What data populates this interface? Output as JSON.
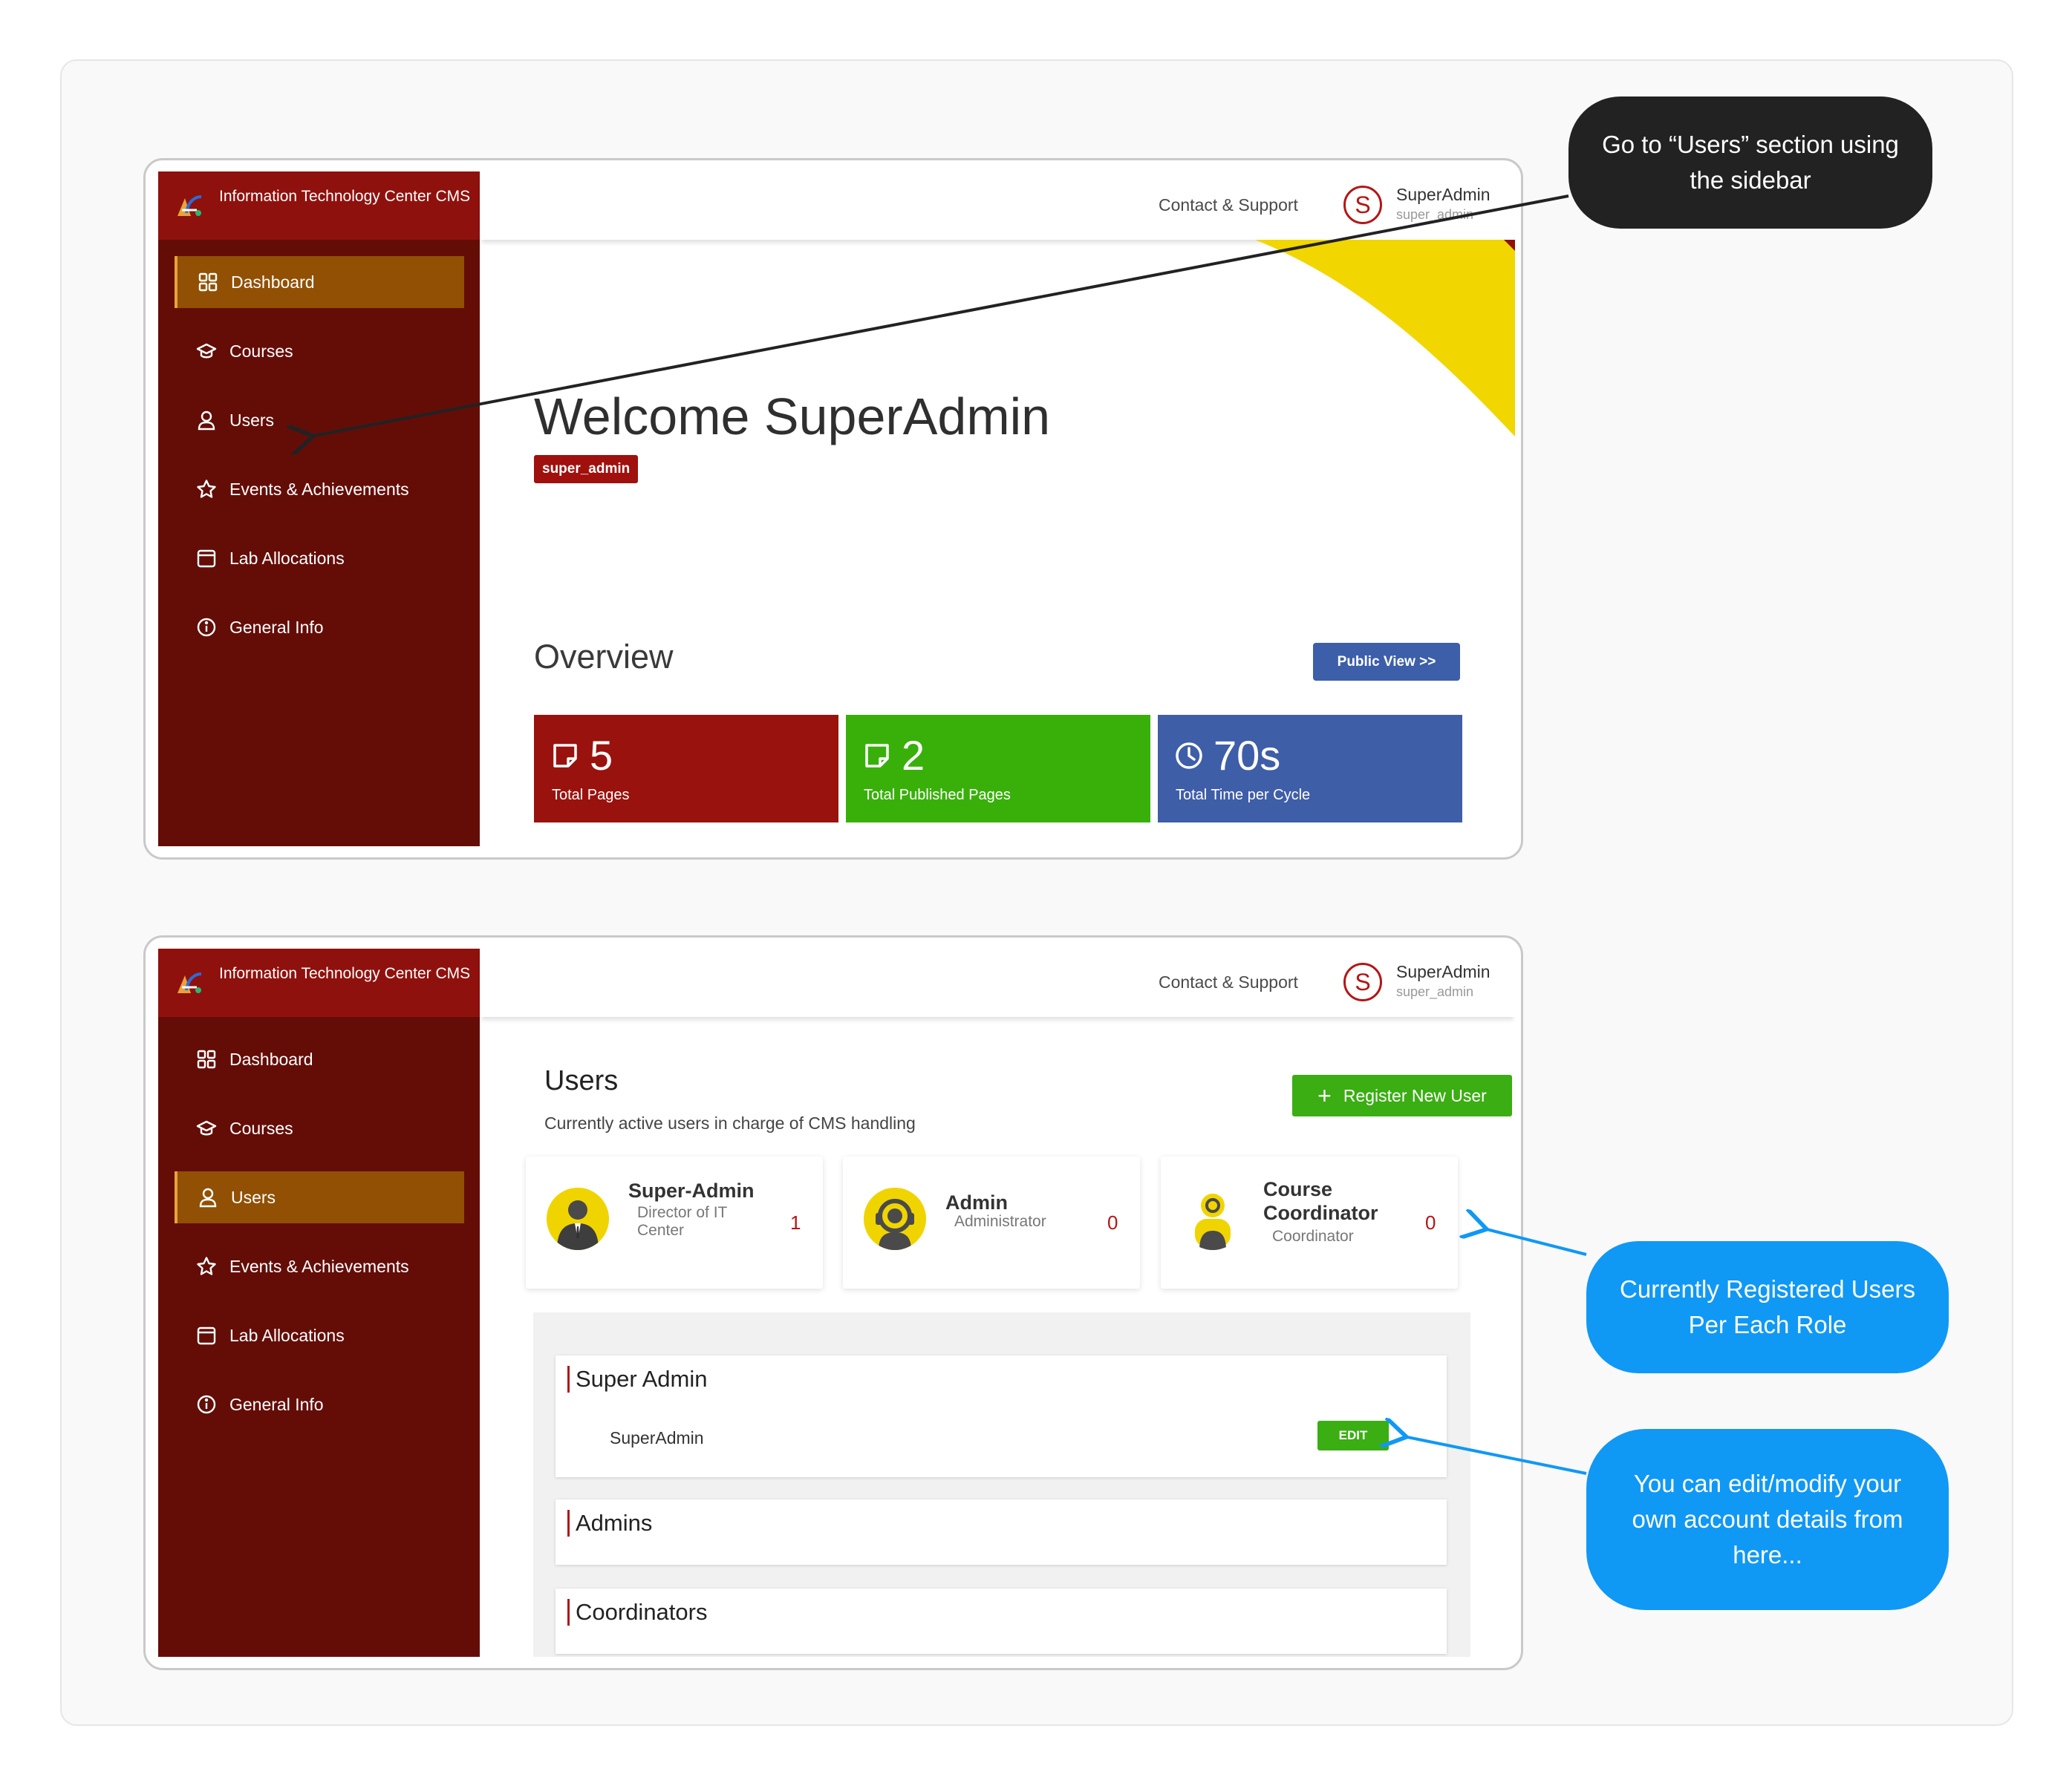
{
  "brand": {
    "name": "Information Technology Center CMS"
  },
  "topbar": {
    "contact": "Contact & Support",
    "avatar_letter": "S",
    "user_name": "SuperAdmin",
    "user_role": "super_admin"
  },
  "sidebar": {
    "items": [
      {
        "label": "Dashboard",
        "icon": "dashboard-icon"
      },
      {
        "label": "Courses",
        "icon": "graduation-cap-icon"
      },
      {
        "label": "Users",
        "icon": "user-icon"
      },
      {
        "label": "Events & Achievements",
        "icon": "star-icon"
      },
      {
        "label": "Lab Allocations",
        "icon": "calendar-icon"
      },
      {
        "label": "General Info",
        "icon": "info-icon"
      }
    ]
  },
  "dashboard": {
    "active_item": "Dashboard",
    "welcome": "Welcome SuperAdmin",
    "role_tag": "super_admin",
    "overview_title": "Overview",
    "public_view": "Public View  >>",
    "stats": [
      {
        "value": "5",
        "label": "Total Pages",
        "color": "#9a120d",
        "icon": "page-icon"
      },
      {
        "value": "2",
        "label": "Total Published Pages",
        "color": "#39b00a",
        "icon": "page-icon"
      },
      {
        "value": "70s",
        "label": "Total Time per Cycle",
        "color": "#3f5ea8",
        "icon": "clock-icon"
      }
    ]
  },
  "users_page": {
    "active_item": "Users",
    "title": "Users",
    "subtitle": "Currently active users in charge of CMS handling",
    "register_label": "Register New User",
    "roles": [
      {
        "name": "Super-Admin",
        "desc": "Director of IT Center",
        "count": "1"
      },
      {
        "name": "Admin",
        "desc": "Administrator",
        "count": "0"
      },
      {
        "name": "Course Coordinator",
        "desc": "Coordinator",
        "count": "0"
      }
    ],
    "groups": [
      {
        "title": "Super Admin",
        "members": [
          {
            "name": "SuperAdmin",
            "action": "EDIT"
          }
        ]
      },
      {
        "title": "Admins",
        "members": []
      },
      {
        "title": "Coordinators",
        "members": []
      }
    ]
  },
  "callouts": {
    "sidebar_hint": "Go to “Users” section using the sidebar",
    "roles_hint": "Currently Registered Users Per Each Role",
    "edit_hint": "You can edit/modify your own account details from here..."
  },
  "colors": {
    "sidebar": "#640d07",
    "brand": "#8f110d",
    "active": "#915003",
    "accent_yellow": "#f0d400",
    "green": "#3aae12",
    "blue": "#3d5ea8",
    "callout_blue": "#1098f5"
  }
}
